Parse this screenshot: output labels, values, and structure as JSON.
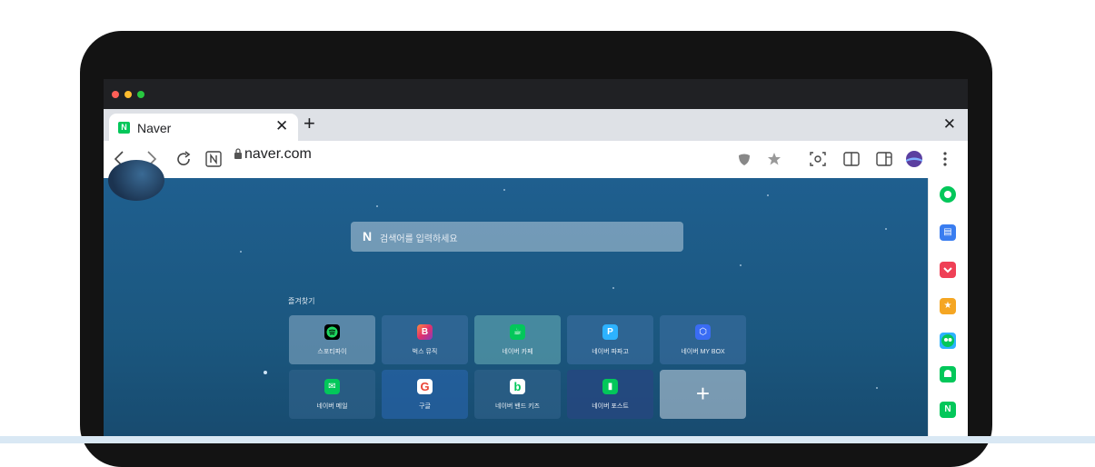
{
  "colors": {
    "naver_green": "#03c75a",
    "content_bg": "#1f5f8f",
    "mac_red": "#ff5f57",
    "mac_yellow": "#febc2e",
    "mac_green": "#28c840"
  },
  "window_controls": [
    "close",
    "minimize",
    "zoom"
  ],
  "tab": {
    "favicon_letter": "N",
    "title": "Naver",
    "close_glyph": "✕"
  },
  "new_tab_glyph": "+",
  "window_close_glyph": "✕",
  "toolbar": {
    "back_glyph": "〈",
    "forward_glyph": "〉",
    "url": "naver.com",
    "icons": [
      "back-icon",
      "forward-icon",
      "reload-icon",
      "naver-home-icon",
      "lock-icon",
      "shield-icon",
      "star-icon",
      "screenshot-icon",
      "split-view-icon",
      "sidebar-icon",
      "profile-avatar",
      "menu-icon"
    ]
  },
  "search": {
    "logo": "N",
    "placeholder": "검색어를 입력하세요"
  },
  "favorites": {
    "label": "즐겨찾기",
    "tiles": [
      {
        "label": "스포티파이",
        "icon": "spotify-icon",
        "color": "#000000"
      },
      {
        "label": "벅스 뮤직",
        "icon": "bugs-icon",
        "color": "#ff4e6a"
      },
      {
        "label": "네이버 카페",
        "icon": "cafe-icon",
        "color": "#03c75a"
      },
      {
        "label": "네이버 파파고",
        "icon": "papago-icon",
        "color": "#2db2ff"
      },
      {
        "label": "네이버 MY BOX",
        "icon": "mybox-icon",
        "color": "#3a6cf4"
      },
      {
        "label": "네이버 메일",
        "icon": "mail-icon",
        "color": "#03c75a"
      },
      {
        "label": "구글",
        "icon": "google-icon",
        "color": "#ffffff"
      },
      {
        "label": "네이버 밴드 키즈",
        "icon": "band-kids-icon",
        "color": "#ffffff"
      },
      {
        "label": "네이버 포스트",
        "icon": "post-icon",
        "color": "#03c75a"
      }
    ],
    "add_glyph": "+"
  },
  "side_panel": {
    "icons": [
      {
        "name": "whale-space-icon",
        "color": "#03c75a"
      },
      {
        "name": "toolbox-icon",
        "color": "#3a7df0"
      },
      {
        "name": "pocket-icon",
        "color": "#ef4056"
      },
      {
        "name": "favorites-icon",
        "color": "#f5a623"
      },
      {
        "name": "papago-icon",
        "color": "#2db2ff"
      },
      {
        "name": "notifications-icon",
        "color": "#03c75a"
      },
      {
        "name": "naver-icon",
        "color": "#03c75a"
      }
    ],
    "naver_letter": "N"
  }
}
